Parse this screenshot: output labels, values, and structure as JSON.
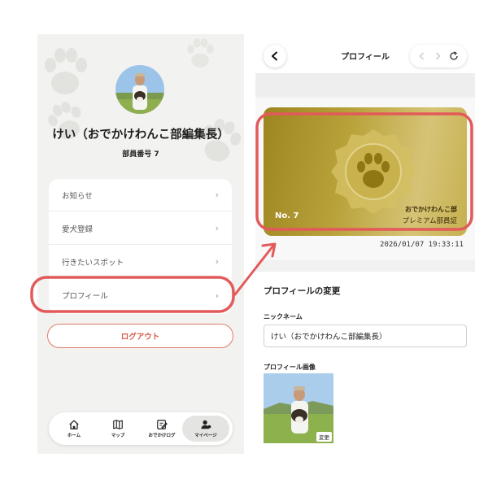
{
  "left": {
    "user_name": "けい（おでかけわんこ部編集長）",
    "member_no": "部員番号 7",
    "menu": [
      {
        "label": "お知らせ"
      },
      {
        "label": "愛犬登録"
      },
      {
        "label": "行きたいスポット"
      },
      {
        "label": "プロフィール"
      }
    ],
    "logout_label": "ログアウト",
    "nav": [
      {
        "label": "ホーム",
        "icon": "home-icon"
      },
      {
        "label": "マップ",
        "icon": "map-icon"
      },
      {
        "label": "おでかけログ",
        "icon": "edit-log-icon"
      },
      {
        "label": "マイページ",
        "icon": "user-icon"
      }
    ],
    "active_nav": "マイページ"
  },
  "right": {
    "header_title": "プロフィール",
    "card": {
      "number": "No. 7",
      "club": "おでかけわんこ部",
      "grade": "プレミアム部員証"
    },
    "timestamp": "2026/01/07 19:33:11",
    "section_title": "プロフィールの変更",
    "nickname_label": "ニックネーム",
    "nickname_value": "けい（おでかけわんこ部編集長）",
    "photo_label": "プロフィール画像",
    "change_label": "変更"
  },
  "colors": {
    "accent": "#d85a45",
    "highlight": "#e25a5a",
    "gold_dark": "#9d8520",
    "gold_light": "#d6c476",
    "background": "#f2f2f0"
  }
}
